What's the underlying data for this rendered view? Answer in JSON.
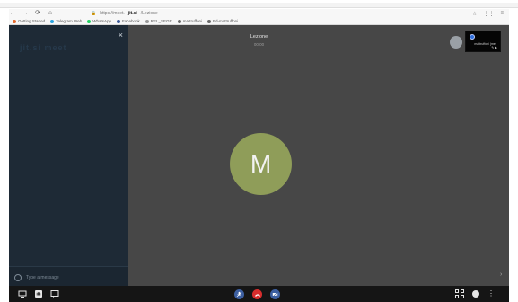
{
  "browser": {
    "url_prefix": "https://meet.",
    "url_domain": "jit.si",
    "url_path": "/Lezione",
    "nav": {
      "back": "←",
      "forward": "→",
      "reload": "⟳",
      "home": "⌂"
    },
    "toolbar_icons": {
      "more": "···",
      "bookmark": "☆",
      "extensions": "⋮⋮",
      "menu": "≡"
    }
  },
  "bookmarks": [
    {
      "label": "Getting Started",
      "color": "#e56b2f"
    },
    {
      "label": "Telegram Web",
      "color": "#2ca5e0"
    },
    {
      "label": "WhatsApp",
      "color": "#25d366"
    },
    {
      "label": "Facebook",
      "color": "#3b5998"
    },
    {
      "label": "REL_SEGR",
      "color": "#9b9b9b"
    },
    {
      "label": "mattruffoni",
      "color": "#6b6b6b"
    },
    {
      "label": "Ed-mattruffoni",
      "color": "#6b6b6b"
    }
  ],
  "meeting": {
    "title": "Lezione",
    "timer": "00:00",
    "avatar_initial": "M",
    "avatar_color": "#8f9d59",
    "ghost_text": "jit.si meet"
  },
  "sidebar": {
    "close": "×",
    "chat_placeholder": "Type a message"
  },
  "thumbnail": {
    "label": "mattruffoni (me)",
    "icons": "✎ ▶"
  },
  "controls": {
    "mic": "mic",
    "hangup": "hangup",
    "camera": "camera"
  },
  "colors": {
    "stage": "#474747",
    "sidebar": "#1e2a36",
    "bottombar": "#151515",
    "hangup": "#d72d2d",
    "toggle": "#3c5fa1"
  }
}
